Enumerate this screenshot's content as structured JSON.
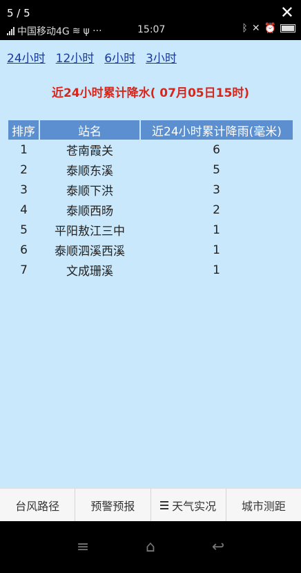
{
  "status_bar": {
    "page_counter": "5 / 5",
    "carrier": "中国移动4G",
    "extra": "ψ ···",
    "time": "15:07"
  },
  "range_tabs": [
    {
      "label": "24小时"
    },
    {
      "label": "12小时"
    },
    {
      "label": "6小时"
    },
    {
      "label": "3小时"
    }
  ],
  "report": {
    "title": "近24小时累计降水( 07月05日15时)",
    "columns": [
      "排序",
      "站名",
      "近24小时累计降雨(毫米)"
    ],
    "rows": [
      {
        "rank": "1",
        "station": "苍南霞关",
        "rain": "6"
      },
      {
        "rank": "2",
        "station": "泰顺东溪",
        "rain": "5"
      },
      {
        "rank": "3",
        "station": "泰顺下洪",
        "rain": "3"
      },
      {
        "rank": "4",
        "station": "泰顺西旸",
        "rain": "2"
      },
      {
        "rank": "5",
        "station": "平阳敖江三中",
        "rain": "1"
      },
      {
        "rank": "6",
        "station": "泰顺泗溪西溪",
        "rain": "1"
      },
      {
        "rank": "7",
        "station": "文成珊溪",
        "rain": "1"
      }
    ]
  },
  "bottom_nav": [
    {
      "label": "台风路径"
    },
    {
      "label": "预警预报"
    },
    {
      "label": "天气实况"
    },
    {
      "label": "城市测距"
    }
  ],
  "colors": {
    "content_bg": "#c9e8fb",
    "header_bg": "#5b8fcf",
    "title_red": "#d8261b",
    "link_blue": "#1a3a9c"
  }
}
